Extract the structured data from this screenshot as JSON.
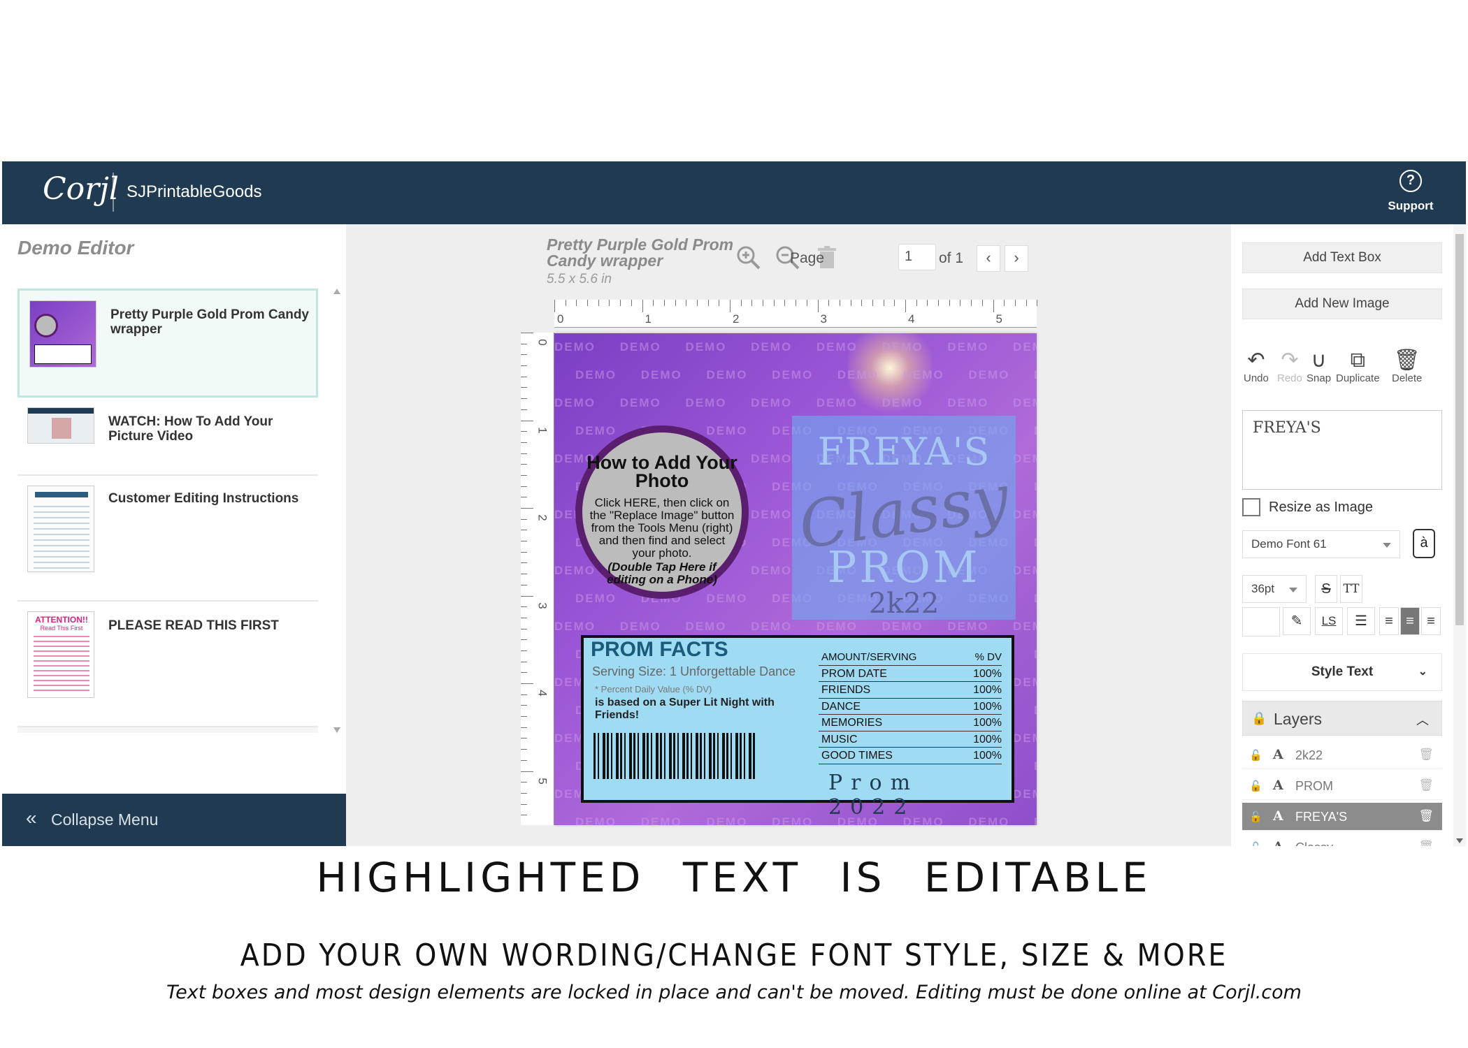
{
  "header": {
    "logo_text": "Corjl",
    "shop_name": "SJPrintableGoods",
    "support_label": "Support"
  },
  "left_panel": {
    "title": "Demo Editor",
    "documents": [
      {
        "title": "Pretty Purple Gold Prom Candy wrapper",
        "selected": true
      },
      {
        "title": "WATCH: How To Add Your Picture Video",
        "selected": false
      },
      {
        "title": "Customer Editing Instructions",
        "selected": false
      },
      {
        "title": "PLEASE READ THIS FIRST",
        "selected": false
      }
    ],
    "thumb_attention": "ATTENTION!!",
    "thumb_read_first": "Read This First",
    "collapse_label": "Collapse Menu"
  },
  "canvas": {
    "project_title": "Pretty Purple Gold Prom Candy wrapper",
    "project_size": "5.5 x 5.6 in",
    "page_label": "Page",
    "page_value": "1",
    "page_of": "of 1",
    "ruler_h": [
      "0",
      "1",
      "2",
      "3",
      "4",
      "5"
    ],
    "ruler_v": [
      "0",
      "1",
      "2",
      "3",
      "4",
      "5"
    ]
  },
  "design": {
    "watermark": "DEMO",
    "freyas": "FREYA'S",
    "classy": "Classy",
    "prom": "PROM",
    "year": "2k22",
    "photo_title": "How to Add Your Photo",
    "photo_body": "Click HERE, then click on the \"Replace Image\" button from the Tools Menu (right) and then find and select your photo.",
    "photo_note": "(Double Tap Here if editing on a Phone)",
    "facts_title": "PROM FACTS",
    "serving_size": "Serving Size: 1 Unforgettable Dance",
    "pdv_note": "* Percent Daily Value (% DV)",
    "based_on": "is based on a Super Lit Night with Friends!",
    "table_head": {
      "k": "AMOUNT/SERVING",
      "v": "% DV"
    },
    "table_rows": [
      {
        "k": "PROM DATE",
        "v": "100%"
      },
      {
        "k": "FRIENDS",
        "v": "100%"
      },
      {
        "k": "DANCE",
        "v": "100%"
      },
      {
        "k": "MEMORIES",
        "v": "100%"
      },
      {
        "k": "MUSIC",
        "v": "100%"
      },
      {
        "k": "GOOD TIMES",
        "v": "100%"
      }
    ],
    "prom_year": "Prom 2022"
  },
  "right_panel": {
    "add_text_box": "Add Text Box",
    "add_new_image": "Add New Image",
    "tools": [
      {
        "name": "undo",
        "label": "Undo",
        "glyph": "↶",
        "disabled": false
      },
      {
        "name": "redo",
        "label": "Redo",
        "glyph": "↷",
        "disabled": true
      },
      {
        "name": "snap",
        "label": "Snap",
        "glyph": "∪",
        "disabled": false
      },
      {
        "name": "duplicate",
        "label": "Duplicate",
        "glyph": "⧉",
        "disabled": false
      },
      {
        "name": "delete",
        "label": "Delete",
        "glyph": "🗑",
        "disabled": false
      }
    ],
    "text_value": "FREYA'S",
    "resize_label": "Resize as Image",
    "font_name": "Demo Font 61",
    "font_preview": "à",
    "font_size": "36pt",
    "strike_btn": "S",
    "tt_btn": "TT",
    "ls_btn": "LS",
    "style_text": "Style Text",
    "layers_label": "Layers",
    "layers": [
      {
        "name": "2k22",
        "selected": false
      },
      {
        "name": "PROM",
        "selected": false
      },
      {
        "name": "FREYA'S",
        "selected": true
      },
      {
        "name": "Classy",
        "selected": false
      }
    ]
  },
  "captions": {
    "line1": "HIGHLIGHTED TEXT IS EDITABLE",
    "line2": "ADD YOUR OWN WORDING/CHANGE FONT STYLE, SIZE & MORE",
    "line3": "Text boxes and most design elements are locked in place and can't be moved. Editing must be done online at Corjl.com"
  },
  "colors": {
    "navy": "#1f3a51",
    "purple": "#8f4fcb",
    "facts_blue": "#9fdcf3"
  }
}
